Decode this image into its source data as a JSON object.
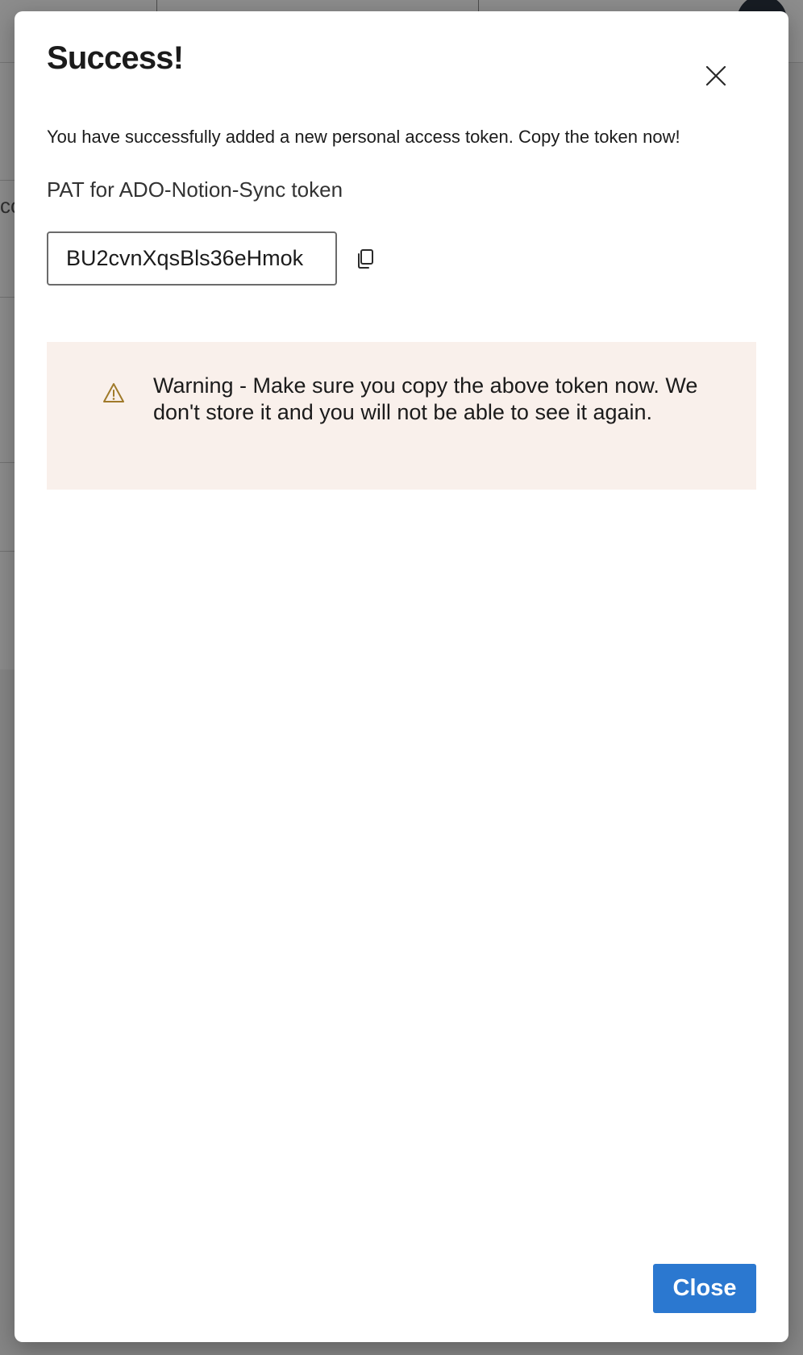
{
  "background": {
    "left_partial_text": "co"
  },
  "dialog": {
    "title": "Success!",
    "message": "You have successfully added a new personal access token. Copy the token now!",
    "token_label": "PAT for ADO-Notion-Sync token",
    "token_value": "BU2cvnXqsBls36eHmok",
    "copy_icon": "copy-icon",
    "close_icon": "close-icon",
    "warning": {
      "icon": "warning-icon",
      "text": "Warning - Make sure you copy the above token now. We don't store it and you will not be able to see it again."
    },
    "close_button_label": "Close"
  },
  "colors": {
    "primary_button": "#2b78d0",
    "warning_background": "#f9f0eb",
    "warning_icon": "#a07a2a"
  }
}
